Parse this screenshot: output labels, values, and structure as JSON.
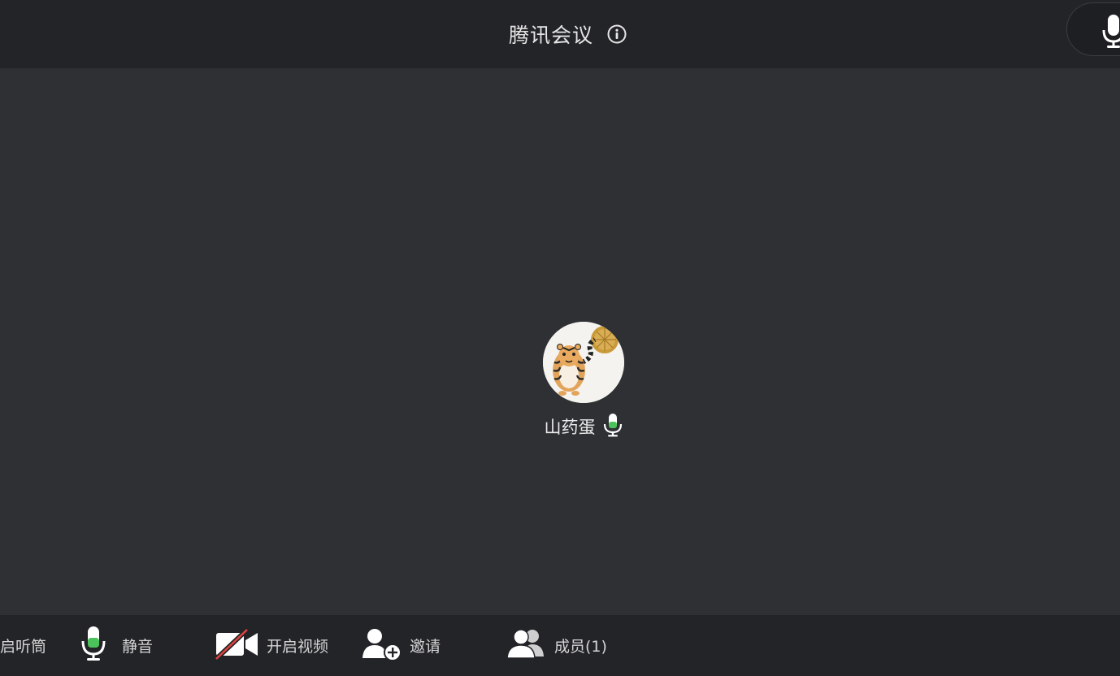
{
  "header": {
    "title": "腾讯会议",
    "info_icon": "info-icon",
    "mic_icon": "microphone-icon"
  },
  "participant": {
    "name": "山药蛋",
    "avatar": "tiger-avatar",
    "mic_icon": "microphone-active-icon",
    "mic_color": "#4cc35a"
  },
  "toolbar": {
    "speaker_label": "启听筒",
    "mute_label": "静音",
    "video_label": "开启视频",
    "invite_label": "邀请",
    "members_label": "成员(1)"
  },
  "colors": {
    "topbar_bg": "#232428",
    "stage_bg": "#2e3034",
    "mic_green": "#4cc35a",
    "video_off_red": "#e0443e"
  }
}
